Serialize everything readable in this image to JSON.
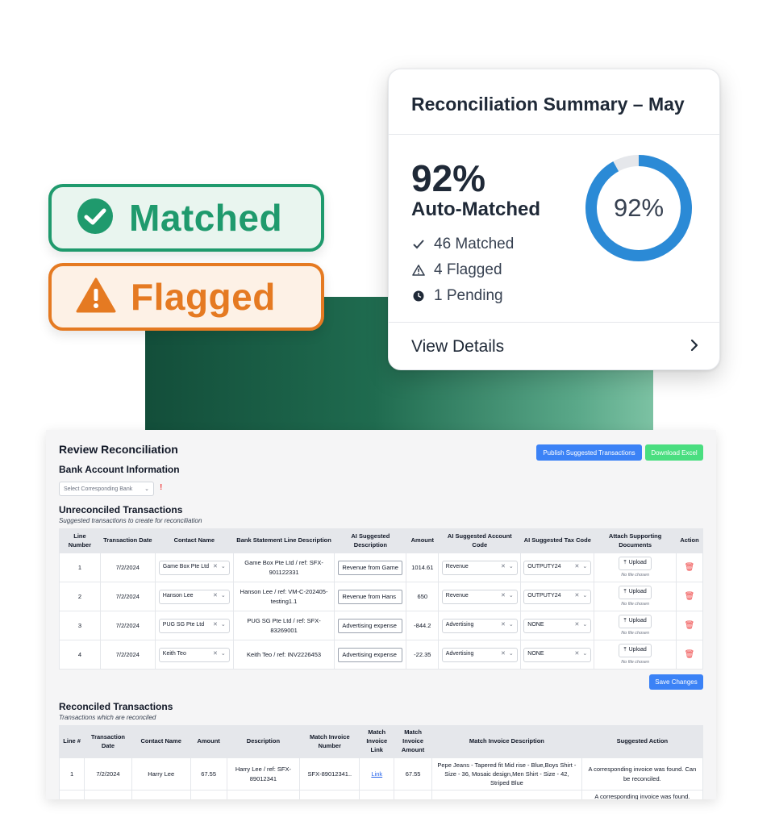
{
  "badges": {
    "matched": {
      "label": "Matched",
      "color": "#1f9a6d",
      "icon": "check-circle-icon"
    },
    "flagged": {
      "label": "Flagged",
      "color": "#e57a22",
      "icon": "warning-triangle-icon"
    }
  },
  "summary": {
    "title": "Reconciliation Summary – May",
    "percent": "92%",
    "percent_label": "Auto-Matched",
    "donut_value": 0.92,
    "donut_label": "92%",
    "stats": [
      {
        "icon": "check-icon",
        "text": "46 Matched"
      },
      {
        "icon": "warning-icon",
        "text": "4 Flagged"
      },
      {
        "icon": "clock-icon",
        "text": "1 Pending"
      }
    ],
    "view_details": "View Details"
  },
  "review": {
    "title": "Review Reconciliation",
    "publish_button": "Publish Suggested Transactions",
    "excel_button": "Download Excel",
    "bank_heading": "Bank Account Information",
    "bank_select_placeholder": "Select Corresponding Bank",
    "bank_warning": "!",
    "unreconciled_heading": "Unreconciled Transactions",
    "unreconciled_sub": "Suggested transactions to create for reconciliation",
    "unreconciled_columns": [
      "Line Number",
      "Transaction Date",
      "Contact Name",
      "Bank Statement Line Description",
      "AI Suggested Description",
      "Amount",
      "AI Suggested Account Code",
      "AI Suggested Tax Code",
      "Attach Supporting Documents",
      "Action"
    ],
    "unreconciled_rows": [
      {
        "line": "1",
        "date": "7/2/2024",
        "contact": "Game Box Pte Ltd",
        "bank_desc": "Game Box Pte Ltd / ref: SFX-901122331",
        "ai_desc": "Revenue from Game",
        "amount": "1014.61",
        "account": "Revenue",
        "tax": "OUTPUTY24",
        "upload": "Upload",
        "nofile": "No file chosen"
      },
      {
        "line": "2",
        "date": "7/2/2024",
        "contact": "Hanson Lee",
        "bank_desc": "Hanson Lee / ref: VM-C-202405-testing1.1",
        "ai_desc": "Revenue from Hans",
        "amount": "650",
        "account": "Revenue",
        "tax": "OUTPUTY24",
        "upload": "Upload",
        "nofile": "No file chosen"
      },
      {
        "line": "3",
        "date": "7/2/2024",
        "contact": "PUG SG Pte Ltd",
        "bank_desc": "PUG SG Pte Ltd / ref: SFX-83269001",
        "ai_desc": "Advertising expense",
        "amount": "-844.2",
        "account": "Advertising",
        "tax": "NONE",
        "upload": "Upload",
        "nofile": "No file chosen"
      },
      {
        "line": "4",
        "date": "7/2/2024",
        "contact": "Keith Teo",
        "bank_desc": "Keith Teo / ref: INV2226453",
        "ai_desc": "Advertising expense",
        "amount": "-22.35",
        "account": "Advertising",
        "tax": "NONE",
        "upload": "Upload",
        "nofile": "No file chosen"
      }
    ],
    "save_button": "Save Changes",
    "reconciled_heading": "Reconciled Transactions",
    "reconciled_sub": "Transactions which are reconciled",
    "reconciled_columns": [
      "Line #",
      "Transaction Date",
      "Contact Name",
      "Amount",
      "Description",
      "Match Invoice Number",
      "Match Invoice Link",
      "Match Invoice Amount",
      "Match Invoice Description",
      "Suggested Action"
    ],
    "reconciled_rows": [
      {
        "line": "1",
        "date": "7/2/2024",
        "contact": "Harry Lee",
        "amount": "67.55",
        "desc": "Harry Lee / ref: SFX-89012341",
        "inv_no": "SFX-89012341..",
        "link": "Link",
        "inv_amount": "67.55",
        "inv_desc": "Pepe Jeans - Tapered fit Mid rise - Blue,Boys Shirt - Size - 36, Mosaic design,Men Shirt - Size - 42, Striped Blue",
        "action": "A corresponding invoice was found. Can be reconciled."
      },
      {
        "line": "",
        "date": "",
        "contact": "",
        "amount": "",
        "desc": "",
        "inv_no": "",
        "link": "",
        "inv_amount": "",
        "inv_desc": "",
        "action": "A corresponding invoice was found."
      }
    ]
  }
}
